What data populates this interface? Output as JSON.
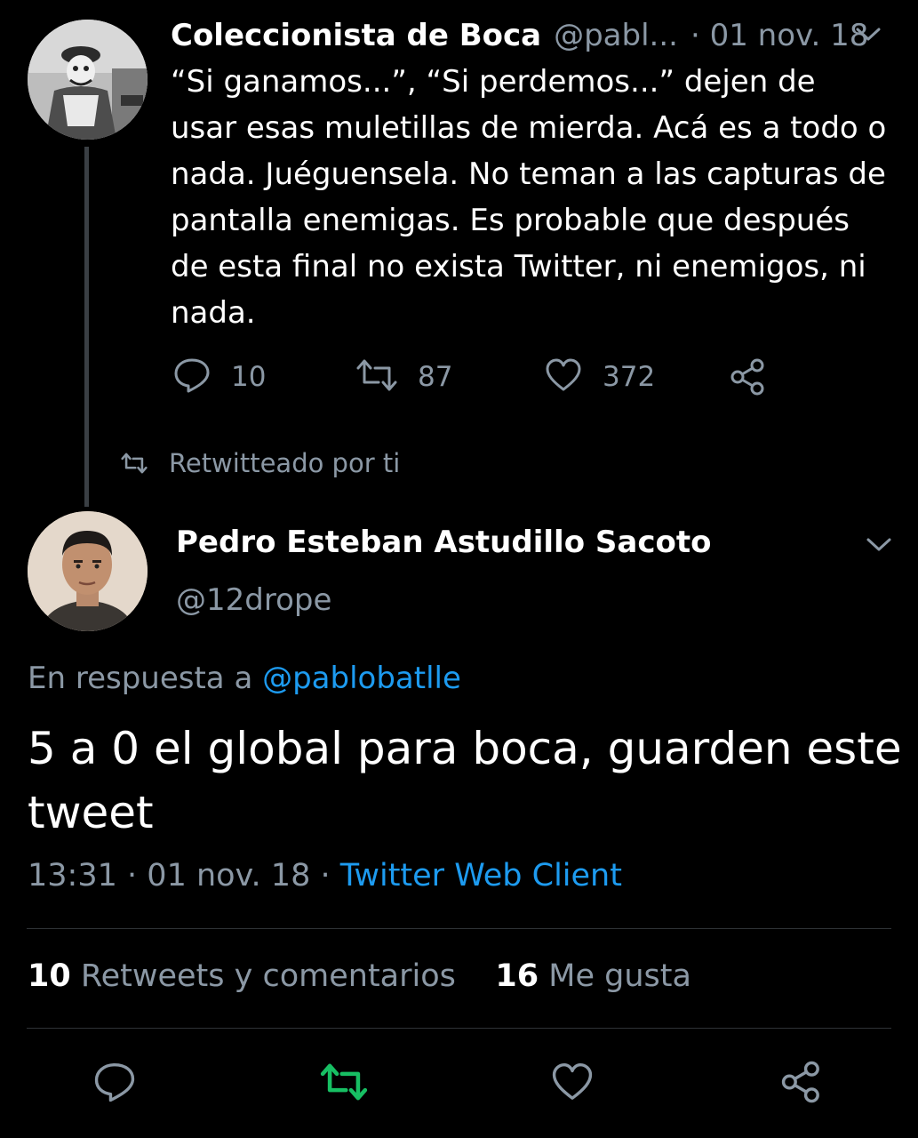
{
  "parent_tweet": {
    "display_name": "Coleccionista de Boca",
    "handle": "@pabl...",
    "date": "· 01 nov. 18",
    "text": "“Si ganamos...”, “Si perdemos...” dejen de usar esas muletillas de mierda. Acá es a todo o nada. Juéguensela. No teman a las capturas de pantalla enemigas. Es probable que después de esta final no exista Twitter, ni enemigos, ni nada.",
    "replies": "10",
    "retweets": "87",
    "likes": "372",
    "icons": [
      "reply-icon",
      "retweet-icon",
      "like-icon",
      "share-icon",
      "chevron-down-icon"
    ]
  },
  "retweet_notice": {
    "text": "Retwitteado por ti",
    "icon": "retweet-icon"
  },
  "main_tweet": {
    "display_name": "Pedro Esteban Astudillo Sacoto",
    "handle": "@12drope",
    "reply_prefix": "En respuesta a",
    "reply_mention": "@pablobatlle",
    "text": "5 a 0 el global para boca, guarden este tweet",
    "time": "13:31",
    "date": "01 nov. 18",
    "separator": "·",
    "client": "Twitter Web Client"
  },
  "stats": {
    "retweets_count": "10",
    "retweets_label": "Retweets y comentarios",
    "likes_count": "16",
    "likes_label": "Me gusta"
  },
  "colors": {
    "background": "#000000",
    "text": "#ffffff",
    "muted": "#8b98a5",
    "link": "#1d9bf0",
    "retweet_active": "#17bf63",
    "divider": "#2f3336"
  }
}
